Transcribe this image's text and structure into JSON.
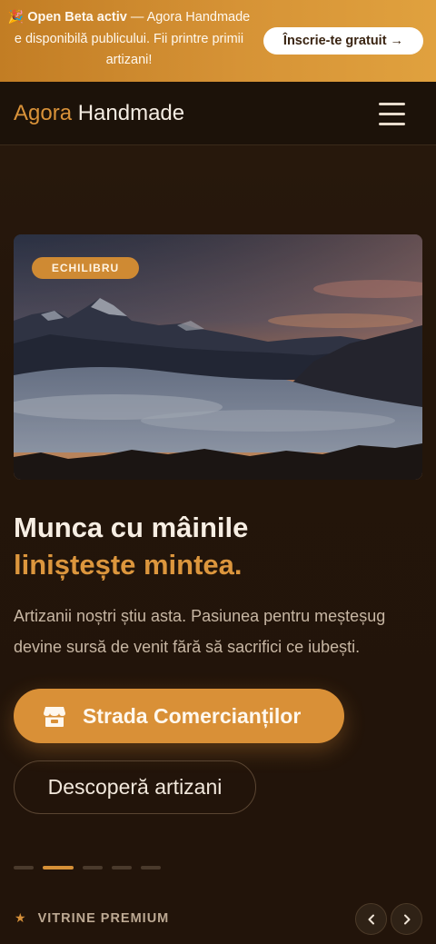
{
  "banner": {
    "emoji": "🎉",
    "strong": "Open Beta activ",
    "rest": " — Agora Handmade e disponibilă publicului. Fii printre primii artizani!",
    "button": "Înscrie-te gratuit →"
  },
  "header": {
    "logo_accent": "Agora",
    "logo_rest": " Handmade"
  },
  "hero": {
    "badge": "ECHILIBRU",
    "title_line1": "Munca cu mâinile",
    "title_line2": "liniștește mintea.",
    "subtitle": "Artizanii noștri știu asta. Pasiunea pentru meșteșug devine sursă de venit fără să sacrifici ce iubești.",
    "primary_cta": "Strada Comercianților",
    "secondary_cta": "Descoperă artizani"
  },
  "carousel": {
    "slides": 5,
    "active_index": 1
  },
  "premium": {
    "star": "★",
    "label": "VITRINE PREMIUM"
  },
  "colors": {
    "accent": "#d99037",
    "banner": "#d69336",
    "background": "#22150b"
  },
  "icons": [
    "celebration-icon",
    "menu-icon",
    "store-icon",
    "star-icon",
    "chevron-left-icon",
    "chevron-right-icon"
  ]
}
